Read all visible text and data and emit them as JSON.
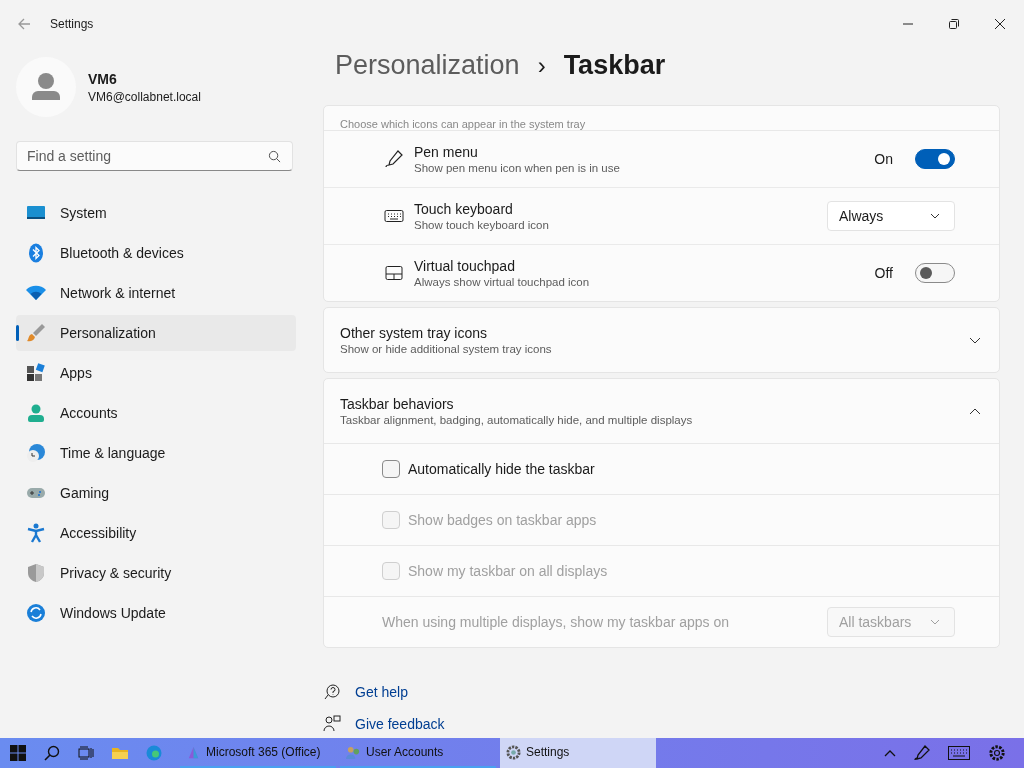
{
  "window": {
    "title": "Settings"
  },
  "profile": {
    "name": "VM6",
    "email": "VM6@collabnet.local"
  },
  "search": {
    "placeholder": "Find a setting"
  },
  "sidebar": {
    "items": [
      {
        "label": "System",
        "selected": false
      },
      {
        "label": "Bluetooth & devices",
        "selected": false
      },
      {
        "label": "Network & internet",
        "selected": false
      },
      {
        "label": "Personalization",
        "selected": true
      },
      {
        "label": "Apps",
        "selected": false
      },
      {
        "label": "Accounts",
        "selected": false
      },
      {
        "label": "Time & language",
        "selected": false
      },
      {
        "label": "Gaming",
        "selected": false
      },
      {
        "label": "Accessibility",
        "selected": false
      },
      {
        "label": "Privacy & security",
        "selected": false
      },
      {
        "label": "Windows Update",
        "selected": false
      }
    ]
  },
  "breadcrumb": {
    "parent": "Personalization",
    "separator": "›",
    "current": "Taskbar"
  },
  "tray_section": {
    "caption": "Choose which icons can appear in the system tray",
    "rows": [
      {
        "kind": "toggle",
        "title": "Pen menu",
        "subtitle": "Show pen menu icon when pen is in use",
        "on": true,
        "state_text": "On"
      },
      {
        "kind": "dropdown",
        "title": "Touch keyboard",
        "subtitle": "Show touch keyboard icon",
        "value": "Always"
      },
      {
        "kind": "toggle",
        "title": "Virtual touchpad",
        "subtitle": "Always show virtual touchpad icon",
        "on": false,
        "state_text": "Off"
      }
    ]
  },
  "other_tray": {
    "title": "Other system tray icons",
    "subtitle": "Show or hide additional system tray icons",
    "expanded": false
  },
  "behaviors": {
    "title": "Taskbar behaviors",
    "subtitle": "Taskbar alignment, badging, automatically hide, and multiple displays",
    "expanded": true,
    "rows": [
      {
        "kind": "checkbox",
        "label": "Automatically hide the taskbar",
        "checked": false,
        "disabled": false
      },
      {
        "kind": "checkbox",
        "label": "Show badges on taskbar apps",
        "checked": false,
        "disabled": true
      },
      {
        "kind": "checkbox",
        "label": "Show my taskbar on all displays",
        "checked": false,
        "disabled": true
      },
      {
        "kind": "dropdown",
        "label": "When using multiple displays, show my taskbar apps on",
        "value": "All taskbars",
        "disabled": true
      }
    ]
  },
  "links": [
    "Get help",
    "Give feedback"
  ],
  "taskbar": {
    "apps": [
      {
        "label": "Microsoft 365 (Office)",
        "selected": false
      },
      {
        "label": "User Accounts",
        "selected": false
      },
      {
        "label": "Settings",
        "selected": true
      }
    ]
  }
}
